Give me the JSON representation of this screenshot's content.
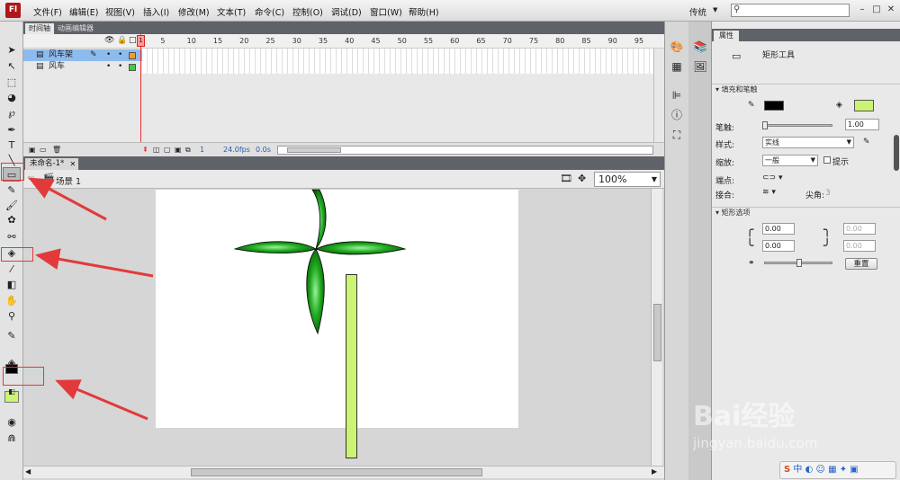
{
  "app": {
    "logo": "Fl",
    "workspace": "传统",
    "search_placeholder": ""
  },
  "menu": [
    "文件(F)",
    "编辑(E)",
    "视图(V)",
    "插入(I)",
    "修改(M)",
    "文本(T)",
    "命令(C)",
    "控制(O)",
    "调试(D)",
    "窗口(W)",
    "帮助(H)"
  ],
  "timeline": {
    "tabs": [
      "时间轴",
      "动画编辑器"
    ],
    "frame_numbers": [
      "1",
      "5",
      "10",
      "15",
      "20",
      "25",
      "30",
      "35",
      "40",
      "45",
      "50",
      "55",
      "60",
      "65",
      "70",
      "75",
      "80",
      "85",
      "90",
      "95"
    ],
    "layers": [
      {
        "name": "风车架",
        "selected": true,
        "color": "#f29a2e"
      },
      {
        "name": "风车",
        "selected": false,
        "color": "#3ccf3c"
      }
    ],
    "footer": {
      "frame": "1",
      "fps": "24.0",
      "fps_unit": "fps",
      "time": "0.0",
      "time_unit": "s"
    }
  },
  "document": {
    "tab_title": "未命名-1*",
    "scene": "场景 1",
    "zoom": "100%"
  },
  "colors": {
    "fill": "#ccf373",
    "stroke": "#000000",
    "blade_green": "#1faa1f"
  },
  "properties": {
    "tab": "属性",
    "tool_name": "矩形工具",
    "fill_stroke_section": "填充和笔触",
    "stroke_width_label": "笔触:",
    "stroke_width_value": "1.00",
    "style_label": "样式:",
    "style_value": "实线",
    "scale_label": "缩放:",
    "scale_value": "一般",
    "hint_label": "提示",
    "cap_label": "端点:",
    "join_label": "接合:",
    "miter_label": "尖角:",
    "miter_value": "3",
    "rect_section": "矩形选项",
    "corner_values": [
      "0.00",
      "0.00",
      "0.00",
      "0.00"
    ],
    "reset_label": "重置"
  },
  "watermark": {
    "brand": "Bai经验",
    "url": "jingyan.baidu.com"
  },
  "ime": {
    "label": "中"
  }
}
